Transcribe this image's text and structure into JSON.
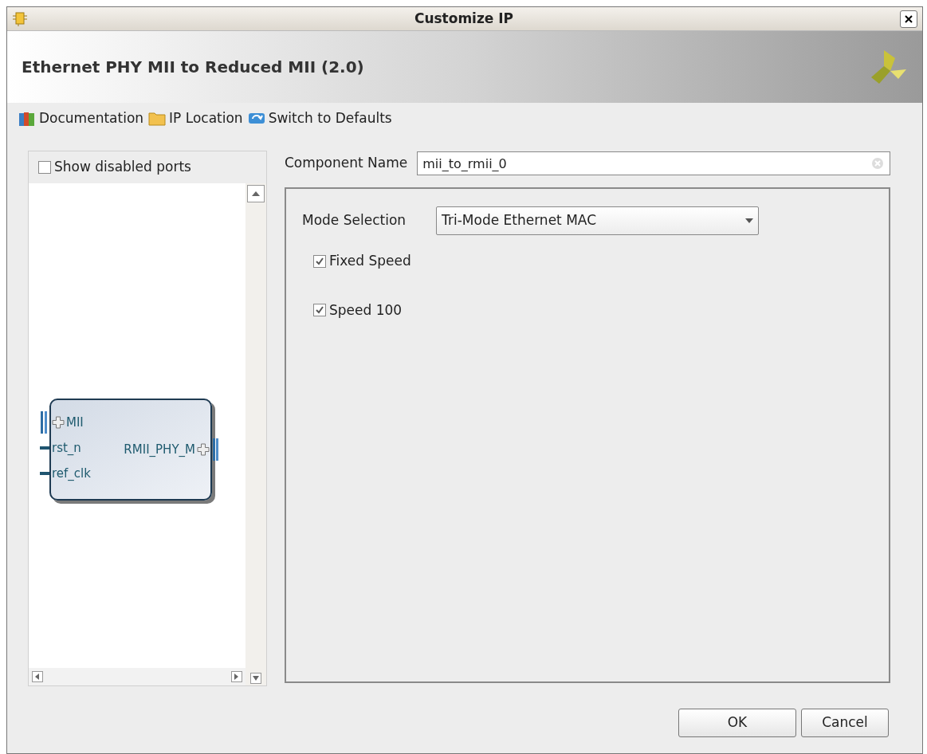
{
  "window": {
    "title": "Customize IP"
  },
  "header": {
    "title": "Ethernet PHY MII to Reduced MII (2.0)"
  },
  "toolbar": [
    {
      "label": "Documentation",
      "kind": "books"
    },
    {
      "label": "IP Location",
      "kind": "folder"
    },
    {
      "label": "Switch to Defaults",
      "kind": "reset"
    }
  ],
  "symbol_panel": {
    "show_disabled_ports": {
      "label": "Show disabled ports",
      "checked": false
    },
    "block": {
      "left_ports": [
        {
          "label": "MII",
          "kind": "bus"
        },
        {
          "label": "rst_n",
          "kind": "wire"
        },
        {
          "label": "ref_clk",
          "kind": "wire"
        }
      ],
      "right_ports": [
        {
          "label": "RMII_PHY_M",
          "kind": "bus"
        }
      ]
    }
  },
  "component_name": {
    "label": "Component Name",
    "value": "mii_to_rmii_0"
  },
  "options": {
    "mode": {
      "label": "Mode Selection",
      "value": "Tri-Mode Ethernet MAC"
    },
    "checkboxes": [
      {
        "label": "Fixed Speed",
        "checked": true
      },
      {
        "label": "Speed 100",
        "checked": true
      }
    ]
  },
  "buttons": [
    "OK",
    "Cancel"
  ]
}
